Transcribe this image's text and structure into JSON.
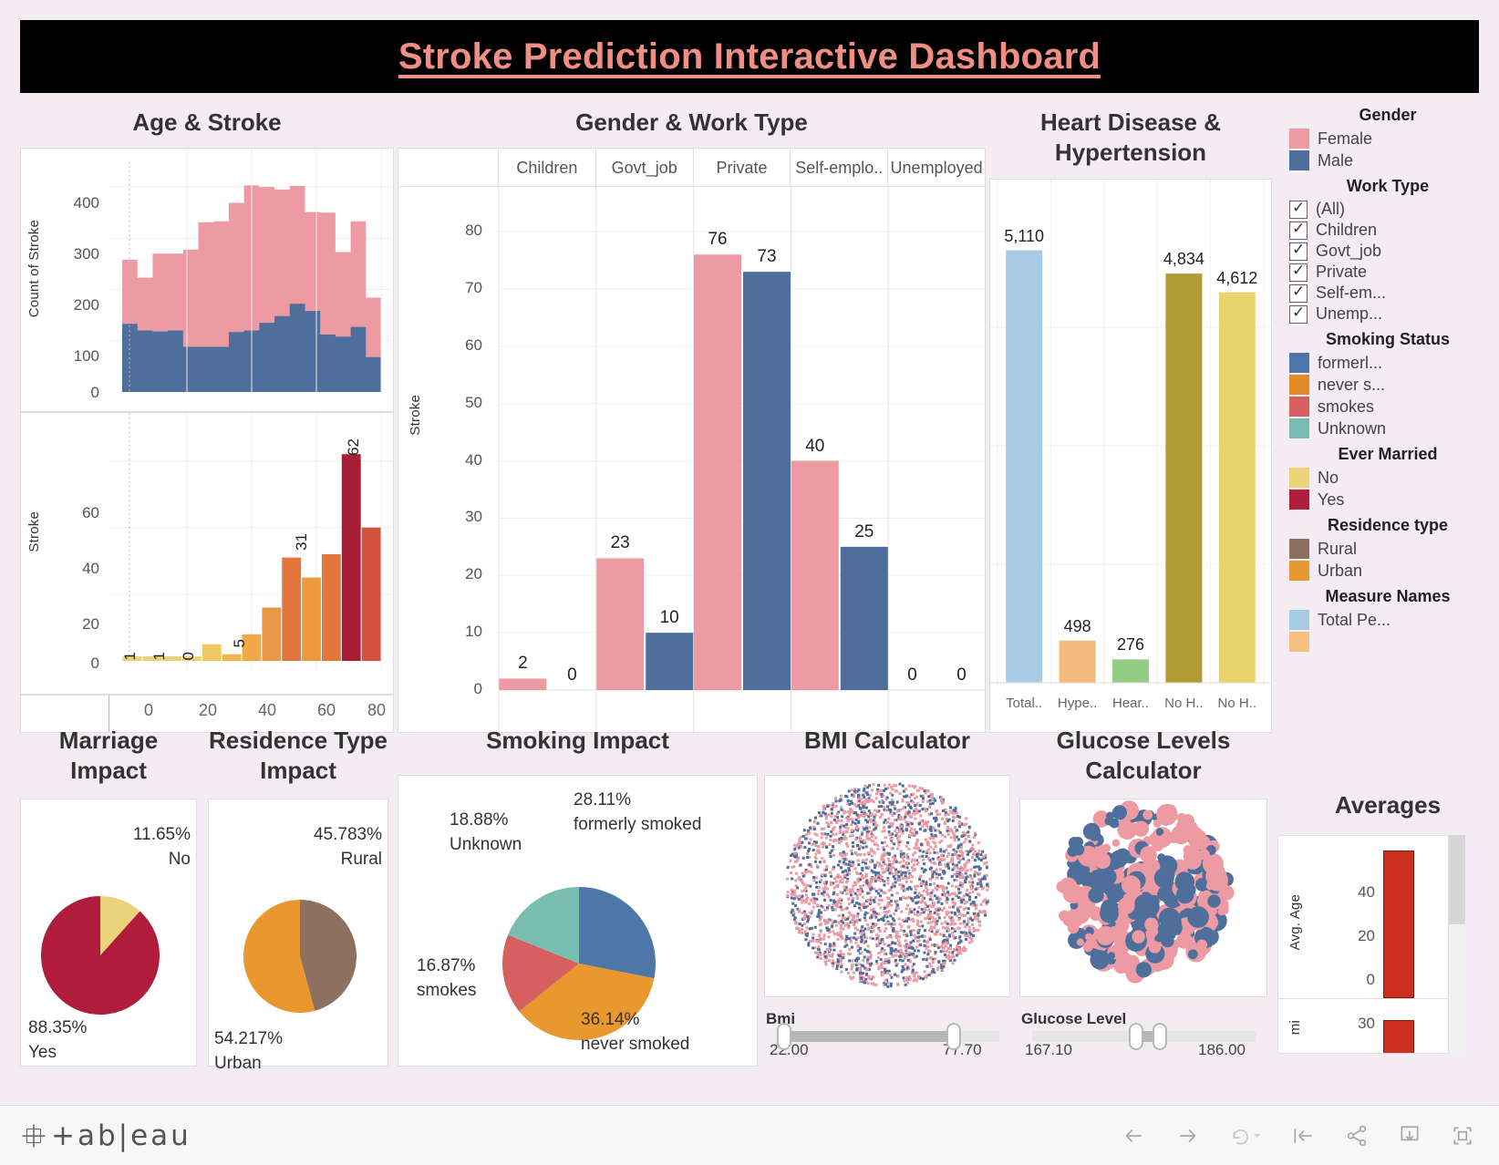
{
  "dashboard": {
    "title": "Stroke Prediction Interactive Dashboard",
    "title_color": "#f08e84",
    "background": "#f3ecf3"
  },
  "panels": {
    "age_stroke": {
      "title": "Age & Stroke",
      "y_axis_top": "Count of Stroke",
      "y_axis_bottom": "Stroke"
    },
    "gender_work": {
      "title": "Gender & Work Type",
      "y_axis": "Stroke"
    },
    "heart_disease": {
      "title": "Heart Disease & Hypertension"
    },
    "marriage": {
      "title": "Marriage Impact"
    },
    "residence": {
      "title": "Residence Type Impact"
    },
    "smoking": {
      "title": "Smoking Impact"
    },
    "bmi": {
      "title": "BMI Calculator"
    },
    "glucose": {
      "title": "Glucose Levels Calculator"
    },
    "averages": {
      "title": "Averages",
      "y_axis_1": "Avg. Age",
      "y_axis_2": "mi"
    }
  },
  "legend": {
    "gender": {
      "heading": "Gender",
      "items": [
        {
          "label": "Female",
          "color": "#ee9aa2"
        },
        {
          "label": "Male",
          "color": "#4e6f9b"
        }
      ]
    },
    "work_type": {
      "heading": "Work Type",
      "items": [
        {
          "label": "(All)",
          "checked": true
        },
        {
          "label": "Children",
          "checked": true
        },
        {
          "label": "Govt_job",
          "checked": true
        },
        {
          "label": "Private",
          "checked": true
        },
        {
          "label": "Self-em...",
          "checked": true
        },
        {
          "label": "Unemp...",
          "checked": true
        }
      ]
    },
    "smoking_status": {
      "heading": "Smoking Status",
      "items": [
        {
          "label": "formerl...",
          "color": "#4e76a8"
        },
        {
          "label": "never s...",
          "color": "#e28b28"
        },
        {
          "label": "smokes",
          "color": "#d65f5f"
        },
        {
          "label": "Unknown",
          "color": "#79bdb2"
        }
      ]
    },
    "ever_married": {
      "heading": "Ever Married",
      "items": [
        {
          "label": "No",
          "color": "#ecd27a"
        },
        {
          "label": "Yes",
          "color": "#b01c3c"
        }
      ]
    },
    "residence_type": {
      "heading": "Residence type",
      "items": [
        {
          "label": "Rural",
          "color": "#8c7162"
        },
        {
          "label": "Urban",
          "color": "#e8982e"
        }
      ]
    },
    "measure_names": {
      "heading": "Measure Names",
      "items": [
        {
          "label": "Total Pe...",
          "color": "#a8cbe5"
        },
        {
          "label": "",
          "color": "#f5c183"
        }
      ]
    }
  },
  "chart_data": [
    {
      "id": "age_stroke_area",
      "type": "area",
      "title": "Age & Stroke",
      "ylabel": "Count of Stroke",
      "xlabel": "",
      "ylim": [
        0,
        450
      ],
      "yticks": [
        0,
        100,
        200,
        300,
        400
      ],
      "xlim": [
        0,
        88
      ],
      "grid": true,
      "categories": [
        4,
        9,
        14,
        19,
        24,
        29,
        34,
        39,
        44,
        49,
        54,
        59,
        64,
        69,
        74,
        79,
        84
      ],
      "series": [
        {
          "name": "Male",
          "color": "#4e6f9b",
          "values": [
            133,
            120,
            118,
            120,
            88,
            88,
            88,
            117,
            120,
            135,
            148,
            172,
            158,
            112,
            108,
            127,
            68
          ]
        },
        {
          "name": "Female",
          "color": "#ee9aa2",
          "values": [
            125,
            103,
            152,
            150,
            190,
            243,
            245,
            252,
            283,
            265,
            247,
            230,
            193,
            238,
            165,
            206,
            116
          ]
        }
      ]
    },
    {
      "id": "age_stroke_bars",
      "type": "bar",
      "ylabel": "Stroke",
      "ylim": [
        -2,
        70
      ],
      "yticks": [
        0,
        20,
        40,
        60
      ],
      "xticks": [
        0,
        20,
        40,
        60,
        80
      ],
      "grid": true,
      "labeled_values": [
        "1",
        "1",
        "0",
        "5",
        "31",
        "62"
      ],
      "bars": [
        {
          "x": 4,
          "value": 1,
          "color": "#ecd27a"
        },
        {
          "x": 13,
          "value": 1,
          "color": "#ecd27a"
        },
        {
          "x": 22,
          "value": 0,
          "color": "#ecd27a"
        },
        {
          "x": 31,
          "value": 1,
          "color": "#ecd27a"
        },
        {
          "x": 38,
          "value": 5,
          "color": "#f0c866"
        },
        {
          "x": 46,
          "value": 2,
          "color": "#f3b54e"
        },
        {
          "x": 52,
          "value": 8,
          "color": "#f0a848"
        },
        {
          "x": 58,
          "value": 16,
          "color": "#eb9746"
        },
        {
          "x": 64,
          "value": 31,
          "color": "#e2763d"
        },
        {
          "x": 70,
          "value": 25,
          "color": "#ee9a3c"
        },
        {
          "x": 75,
          "value": 32,
          "color": "#e2763d"
        },
        {
          "x": 80,
          "value": 62,
          "color": "#a81c35"
        },
        {
          "x": 85,
          "value": 40,
          "color": "#d3523c"
        }
      ]
    },
    {
      "id": "gender_work_type",
      "type": "bar",
      "title": "Gender & Work Type",
      "ylabel": "Stroke",
      "ylim": [
        0,
        84
      ],
      "yticks": [
        0,
        10,
        20,
        30,
        40,
        50,
        60,
        70,
        80
      ],
      "grid": true,
      "categories": [
        "Children",
        "Govt_job",
        "Private",
        "Self-emplo..",
        "Unemployed"
      ],
      "series": [
        {
          "name": "Female",
          "color": "#ee9aa2",
          "values": [
            2,
            23,
            76,
            40,
            0
          ]
        },
        {
          "name": "Male",
          "color": "#4e6f9b",
          "values": [
            0,
            10,
            73,
            25,
            0
          ]
        }
      ]
    },
    {
      "id": "heart_disease_hypertension",
      "type": "bar",
      "title": "Heart Disease & Hypertension",
      "ylim": [
        0,
        5600
      ],
      "yticks": [
        0
      ],
      "grid": true,
      "categories": [
        "Total..",
        "Hype..",
        "Hear..",
        "No H..",
        "No H.."
      ],
      "values": [
        5110,
        498,
        276,
        4834,
        4612
      ],
      "value_labels": [
        "5,110",
        "498",
        "276",
        "4,834",
        "4,612"
      ],
      "colors": [
        "#a8cbe5",
        "#f5bb7c",
        "#94cc83",
        "#b39b33",
        "#e9d36a"
      ]
    },
    {
      "id": "marriage_impact",
      "type": "pie",
      "title": "Marriage Impact",
      "labels": [
        "No",
        "Yes"
      ],
      "values": [
        11.65,
        88.35
      ],
      "value_labels": [
        "11.65%",
        "88.35%"
      ],
      "colors": [
        "#ecd27a",
        "#b01c3c"
      ]
    },
    {
      "id": "residence_type_impact",
      "type": "pie",
      "title": "Residence Type Impact",
      "labels": [
        "Rural",
        "Urban"
      ],
      "values": [
        45.783,
        54.217
      ],
      "value_labels": [
        "45.783%",
        "54.217%"
      ],
      "colors": [
        "#8c7162",
        "#e8982e"
      ]
    },
    {
      "id": "smoking_impact",
      "type": "pie",
      "title": "Smoking Impact",
      "labels": [
        "formerly smoked",
        "never smoked",
        "smokes",
        "Unknown"
      ],
      "values": [
        28.11,
        36.14,
        16.87,
        18.88
      ],
      "value_labels": [
        "28.11%",
        "36.14%",
        "16.87%",
        "18.88%"
      ],
      "colors": [
        "#4e76a8",
        "#e8982e",
        "#d65f5f",
        "#79bdb2"
      ]
    },
    {
      "id": "bmi_calculator",
      "type": "scatter",
      "title": "BMI Calculator",
      "filter_label": "Bmi",
      "range_min": "22.00",
      "range_max": "77.70",
      "colors": [
        "#ee9aa2",
        "#4e6f9b"
      ]
    },
    {
      "id": "glucose_calculator",
      "type": "scatter",
      "title": "Glucose Levels Calculator",
      "filter_label": "Glucose Level",
      "range_min": "167.10",
      "range_max": "186.00",
      "colors": [
        "#ee9aa2",
        "#4e6f9b"
      ]
    },
    {
      "id": "averages",
      "type": "bar",
      "title": "Averages",
      "ylabel_1": "Avg. Age",
      "yticks_1": [
        0,
        20,
        40
      ],
      "ylabel_2": "mi",
      "yticks_2": [
        30
      ],
      "color": "#cc2f1e"
    }
  ],
  "sliders": {
    "bmi": {
      "label": "Bmi",
      "min": "22.00",
      "max": "77.70"
    },
    "glucose": {
      "label": "Glucose Level",
      "min": "167.10",
      "max": "186.00"
    }
  },
  "toolbar": {
    "logo_text": "+ab|eau",
    "icons": [
      "back-arrow",
      "forward-arrow",
      "revert-dropdown",
      "reset-arrow",
      "share",
      "download",
      "fullscreen"
    ]
  }
}
